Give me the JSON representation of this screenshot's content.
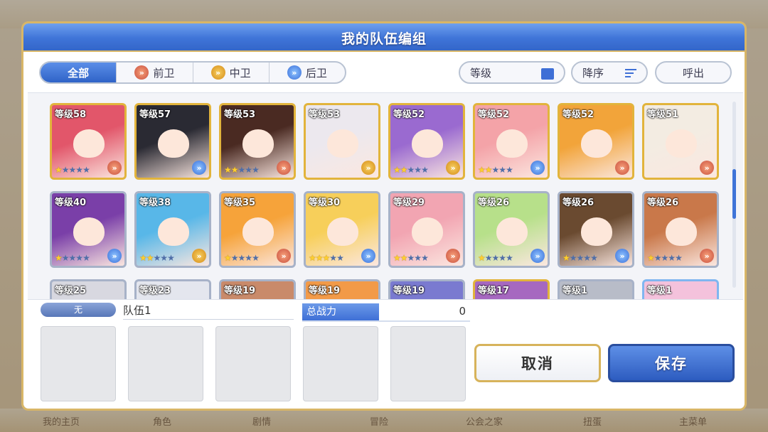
{
  "background_tabs": [
    "我的主页",
    "角色",
    "剧情",
    "冒险",
    "公会之家",
    "扭蛋",
    "主菜单"
  ],
  "dialog": {
    "title": "我的队伍编组"
  },
  "filters": {
    "tabs": [
      {
        "label": "全部",
        "active": true,
        "icon": ""
      },
      {
        "label": "前卫",
        "active": false,
        "icon": "front-position-icon"
      },
      {
        "label": "中卫",
        "active": false,
        "icon": "middle-position-icon"
      },
      {
        "label": "后卫",
        "active": false,
        "icon": "back-position-icon"
      }
    ],
    "level_label": "等级",
    "sort_label": "降序",
    "call_label": "呼出"
  },
  "characters": [
    {
      "level": "等级58",
      "stars": 1,
      "frame": "gold",
      "pos": "front",
      "hair": "#e2566a"
    },
    {
      "level": "等级57",
      "stars": 0,
      "frame": "gold",
      "pos": "back",
      "hair": "#2a2a33"
    },
    {
      "level": "等级53",
      "stars": 2,
      "frame": "gold",
      "pos": "front",
      "hair": "#4a2a22"
    },
    {
      "level": "等级53",
      "stars": 0,
      "frame": "gold",
      "pos": "mid",
      "hair": "#ece8ee"
    },
    {
      "level": "等级52",
      "stars": 2,
      "frame": "gold",
      "pos": "mid",
      "hair": "#9a6ad0"
    },
    {
      "level": "等级52",
      "stars": 2,
      "frame": "gold",
      "pos": "back",
      "hair": "#f4a3a8"
    },
    {
      "level": "等级52",
      "stars": 0,
      "frame": "gold",
      "pos": "front",
      "hair": "#f2a43a"
    },
    {
      "level": "等级51",
      "stars": 0,
      "frame": "gold",
      "pos": "front",
      "hair": "#f3ece2"
    },
    {
      "level": "等级40",
      "stars": 1,
      "frame": "silver",
      "pos": "back",
      "hair": "#7a3fa8"
    },
    {
      "level": "等级38",
      "stars": 2,
      "frame": "silver",
      "pos": "mid",
      "hair": "#58b7e8"
    },
    {
      "level": "等级35",
      "stars": 1,
      "frame": "silver",
      "pos": "front",
      "hair": "#f6a33a"
    },
    {
      "level": "等级30",
      "stars": 3,
      "frame": "silver",
      "pos": "back",
      "hair": "#f7cf5a"
    },
    {
      "level": "等级29",
      "stars": 2,
      "frame": "silver",
      "pos": "front",
      "hair": "#f2a5b2"
    },
    {
      "level": "等级26",
      "stars": 1,
      "frame": "silver",
      "pos": "back",
      "hair": "#b7e08a"
    },
    {
      "level": "等级26",
      "stars": 1,
      "frame": "silver",
      "pos": "back",
      "hair": "#6a4a30"
    },
    {
      "level": "等级26",
      "stars": 1,
      "frame": "silver",
      "pos": "front",
      "hair": "#c9784a"
    },
    {
      "level": "等级25",
      "stars": 0,
      "frame": "silver",
      "pos": "front",
      "hair": "#d8d8e0"
    },
    {
      "level": "等级23",
      "stars": 0,
      "frame": "silver",
      "pos": "front",
      "hair": "#e4e6ee"
    },
    {
      "level": "等级19",
      "stars": 0,
      "frame": "silver",
      "pos": "front",
      "hair": "#c98a6a"
    },
    {
      "level": "等级19",
      "stars": 0,
      "frame": "silver",
      "pos": "front",
      "hair": "#f29a48"
    },
    {
      "level": "等级19",
      "stars": 0,
      "frame": "silver",
      "pos": "front",
      "hair": "#7a7ad0"
    },
    {
      "level": "等级17",
      "stars": 0,
      "frame": "gold",
      "pos": "front",
      "hair": "#a668c0"
    },
    {
      "level": "等级1",
      "stars": 0,
      "frame": "silver",
      "pos": "front",
      "hair": "#b8bcc8"
    },
    {
      "level": "等级1",
      "stars": 0,
      "frame": "blue",
      "pos": "front",
      "hair": "#f4c2dc"
    }
  ],
  "team": {
    "tag": "无",
    "name": "队伍1",
    "power_label": "总战力",
    "power_value": "0",
    "slots": 5
  },
  "buttons": {
    "cancel": "取消",
    "save": "保存"
  },
  "colors": {
    "header_blue": "#3f74d8",
    "frame_gold": "#e2b43c",
    "accent": "#3e6fd6"
  }
}
